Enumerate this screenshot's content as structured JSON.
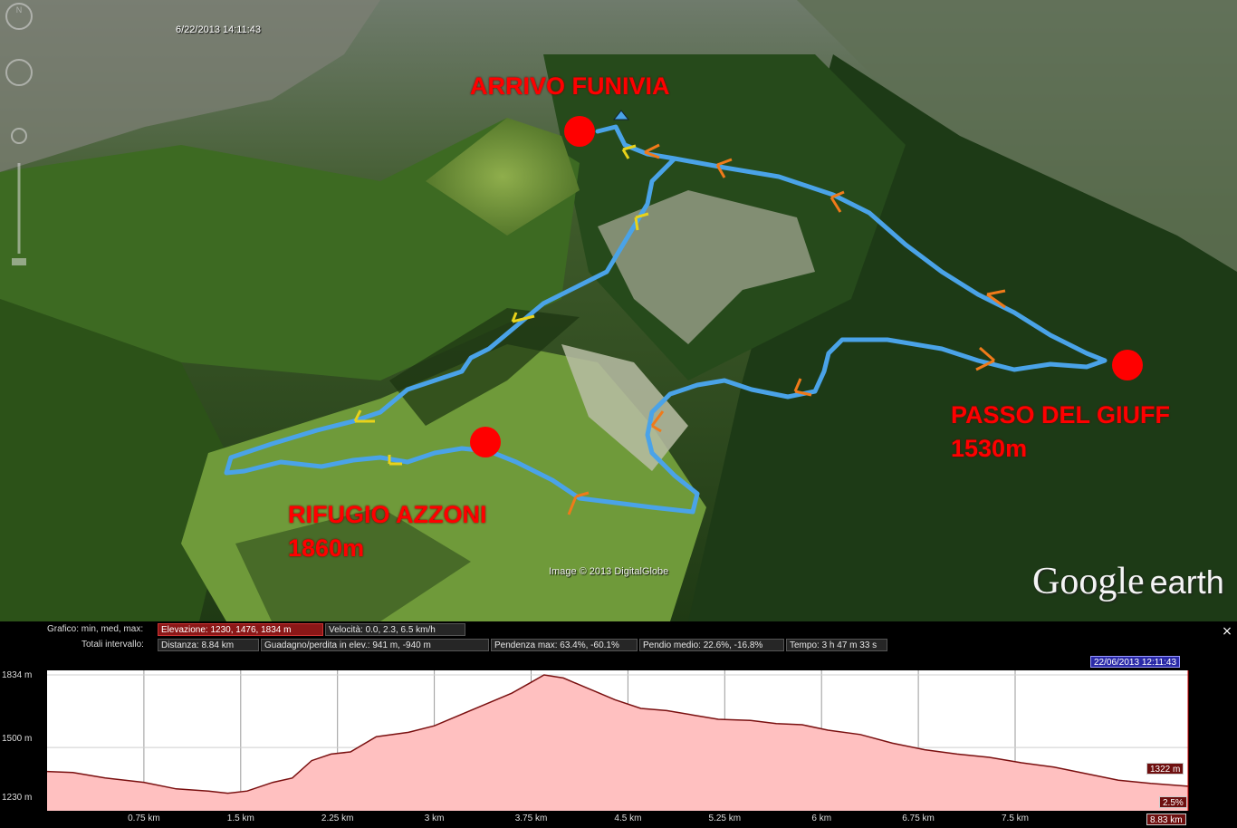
{
  "map": {
    "timestamp": "6/22/2013 14:11:43",
    "labels": {
      "arrivo": "ARRIVO FUNIVIA",
      "passo_line1": "PASSO DEL GIUFF",
      "passo_line2": "1530m",
      "rifugio_line1": "RIFUGIO AZZONI",
      "rifugio_line2": "1860m"
    },
    "credit": "Image © 2013 DigitalGlobe",
    "brand": {
      "google": "Google",
      "earth": "earth"
    },
    "colors": {
      "track": "#4aa3e8",
      "marker": "#ff0000",
      "arrow_yellow": "#e8d21a",
      "arrow_orange": "#f07a1a"
    }
  },
  "profile": {
    "close_label": "×",
    "row1": {
      "grafico": "Grafico: min, med, max:",
      "elevazione": "Elevazione: 1230, 1476, 1834 m",
      "velocita": "Velocità: 0.0, 2.3, 6.5 km/h"
    },
    "row2": {
      "totali": "Totali intervallo:",
      "distanza": "Distanza: 8.84 km",
      "guadagno": "Guadagno/perdita in elev.: 941 m, -940 m",
      "pendenza": "Pendenza max: 63.4%, -60.1%",
      "pendio": "Pendio medio: 22.6%, -16.8%",
      "tempo": "Tempo: 3 h 47 m 33 s"
    },
    "cursor_date": "22/06/2013 12:11:43",
    "cursor_elev": "1322 m",
    "cursor_slope": "2.5%",
    "cursor_dist": "8.83 km",
    "colors": {
      "fill": "#ffc0c0",
      "line": "#7a1010",
      "grid": "#9a9a9a"
    }
  },
  "chart_data": {
    "type": "area",
    "ylabel": "",
    "xlabel": "",
    "ylim": [
      1230,
      1834
    ],
    "xlim": [
      0,
      8.84
    ],
    "yticks": [
      "1834 m",
      "1500 m",
      "1230 m"
    ],
    "xticks": [
      "0.75 km",
      "1.5 km",
      "2.25 km",
      "3 km",
      "3.75 km",
      "4.5 km",
      "5.25 km",
      "6 km",
      "6.75 km",
      "7.5 km"
    ],
    "series": [
      {
        "x": [
          0,
          0.2,
          0.45,
          0.75,
          1.0,
          1.25,
          1.4,
          1.55,
          1.75,
          1.9,
          2.05,
          2.2,
          2.35,
          2.55,
          2.8,
          3.0,
          3.2,
          3.4,
          3.6,
          3.75,
          3.85,
          4.0,
          4.2,
          4.4,
          4.6,
          4.8,
          5.0,
          5.2,
          5.45,
          5.65,
          5.85,
          6.05,
          6.3,
          6.55,
          6.8,
          7.05,
          7.3,
          7.55,
          7.8,
          8.05,
          8.3,
          8.55,
          8.84
        ],
        "y": [
          1390,
          1385,
          1360,
          1340,
          1310,
          1300,
          1290,
          1300,
          1340,
          1360,
          1440,
          1470,
          1480,
          1550,
          1570,
          1600,
          1650,
          1700,
          1750,
          1800,
          1834,
          1820,
          1770,
          1720,
          1680,
          1670,
          1650,
          1630,
          1625,
          1610,
          1605,
          1580,
          1560,
          1520,
          1490,
          1470,
          1455,
          1430,
          1410,
          1380,
          1350,
          1335,
          1322
        ]
      }
    ],
    "grid": true
  }
}
